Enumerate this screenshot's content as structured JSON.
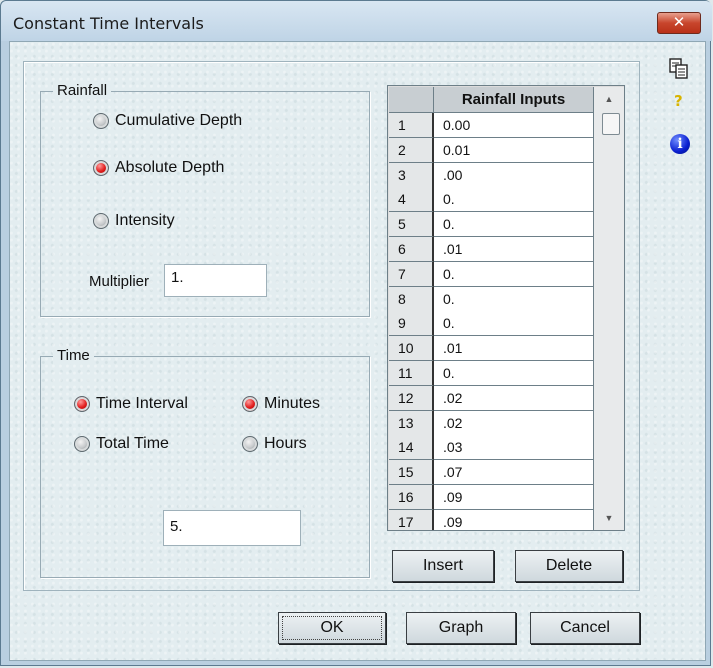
{
  "window": {
    "title": "Constant Time Intervals",
    "close_label": "✕"
  },
  "sidebar": {
    "copy_icon": "copy-icon",
    "help_icon": "help-icon",
    "info_icon": "info-icon",
    "help_glyph": "?",
    "info_glyph": "i"
  },
  "rainfall": {
    "legend": "Rainfall",
    "options": [
      {
        "label": "Cumulative Depth",
        "selected": false
      },
      {
        "label": "Absolute Depth",
        "selected": true
      },
      {
        "label": "Intensity",
        "selected": false
      }
    ],
    "multiplier_label": "Multiplier",
    "multiplier_value": "1."
  },
  "time": {
    "legend": "Time",
    "mode_options": [
      {
        "label": "Time Interval",
        "selected": true
      },
      {
        "label": "Total Time",
        "selected": false
      }
    ],
    "unit_options": [
      {
        "label": "Minutes",
        "selected": true
      },
      {
        "label": "Hours",
        "selected": false
      }
    ],
    "value": "5."
  },
  "grid": {
    "header": "Rainfall Inputs",
    "rows": [
      {
        "num": "1",
        "value": "0.00"
      },
      {
        "num": "2",
        "value": "0.01"
      },
      {
        "num": "3",
        "value": ".00"
      },
      {
        "num": "4",
        "value": "0."
      },
      {
        "num": "5",
        "value": "0."
      },
      {
        "num": "6",
        "value": ".01"
      },
      {
        "num": "7",
        "value": "0."
      },
      {
        "num": "8",
        "value": "0."
      },
      {
        "num": "9",
        "value": "0."
      },
      {
        "num": "10",
        "value": ".01"
      },
      {
        "num": "11",
        "value": "0."
      },
      {
        "num": "12",
        "value": ".02"
      },
      {
        "num": "13",
        "value": ".02"
      },
      {
        "num": "14",
        "value": ".03"
      },
      {
        "num": "15",
        "value": ".07"
      },
      {
        "num": "16",
        "value": ".09"
      },
      {
        "num": "17",
        "value": ".09"
      }
    ]
  },
  "grid_buttons": {
    "insert": "Insert",
    "delete": "Delete"
  },
  "footer": {
    "ok": "OK",
    "graph": "Graph",
    "cancel": "Cancel"
  }
}
